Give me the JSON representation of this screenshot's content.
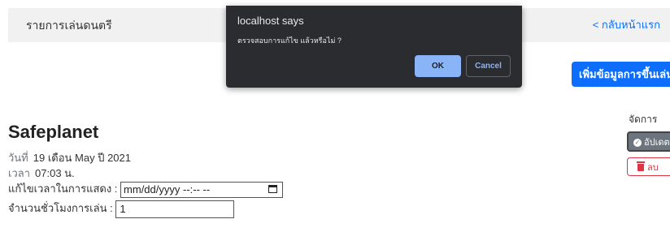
{
  "header": {
    "title": "รายการเล่นดนตรี",
    "back_link": "< กลับหน้าแรก"
  },
  "toolbar": {
    "add_label": "เพิ่มข้อมูลการขึ้นเล่น"
  },
  "detail": {
    "band_name": "Safeplanet",
    "date_label": "วันที่",
    "date_value": "19 เดือน May ปี 2021",
    "time_label": "เวลา",
    "time_value": "07:03 น.",
    "edit_time_label": "แก้ไขเวลาในการแสดง :",
    "edit_time_placeholder": "mm/dd/yyyy --:-- --",
    "hours_label": "จำนวนชั่วโมงการเล่น :",
    "hours_value": "1"
  },
  "actions": {
    "manage_label": "จัดการ",
    "update_label": "อัปเดต",
    "delete_label": "ลบ"
  },
  "dialog": {
    "title": "localhost says",
    "message": "ตรวจสอบการแก้ไข แล้วหรือไม่ ?",
    "ok_label": "OK",
    "cancel_label": "Cancel"
  },
  "colors": {
    "primary": "#0d6efd",
    "danger": "#dc3545",
    "secondary": "#6c757d",
    "dialog_bg": "#2b2c30",
    "dialog_accent": "#8ab4f8"
  }
}
